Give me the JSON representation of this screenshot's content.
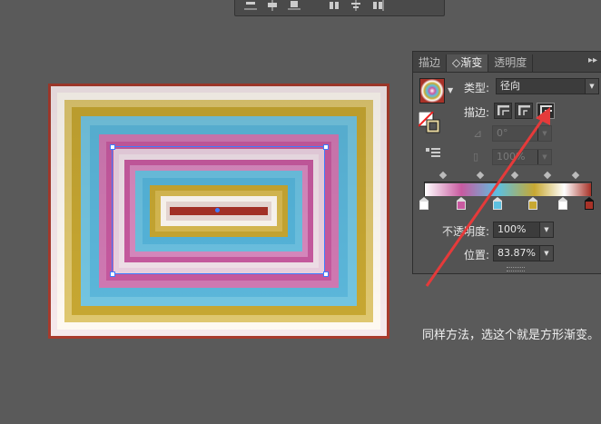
{
  "toolbar": {
    "icons": [
      "align-bottom-icon",
      "align-vcenter-icon",
      "align-top-icon",
      "distribute-left-icon",
      "distribute-hcenter-icon",
      "distribute-right-icon"
    ]
  },
  "gradient_panel": {
    "tabs": [
      "描边",
      "◇渐变",
      "透明度"
    ],
    "active_tab": "◇渐变",
    "type_label": "类型:",
    "type_value": "径向",
    "stroke_label": "描边:",
    "angle_value": "0°",
    "ratio_value": "100%",
    "opacity_label": "不透明度:",
    "opacity_value": "100%",
    "location_label": "位置:",
    "location_value": "83.87%",
    "stops": [
      "#ffffff",
      "#c85aa0",
      "#5cc0e0",
      "#c8a832",
      "#ffffff",
      "#a83228"
    ]
  },
  "caption": "同样方法，选这个就是方形渐变。",
  "colors": {
    "annotation_arrow": "#e53a3a",
    "selection": "#3f7bff",
    "canvas_bg": "#5a5a5a"
  }
}
